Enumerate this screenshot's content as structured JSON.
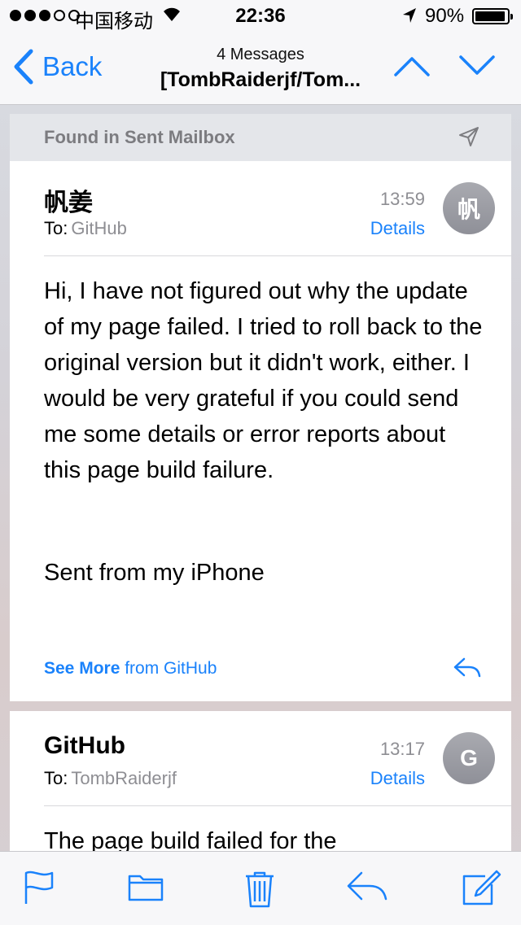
{
  "status_bar": {
    "carrier": "中国移动",
    "time": "22:36",
    "battery": "90%"
  },
  "nav": {
    "back_label": "Back",
    "subtitle": "4 Messages",
    "title": "[TombRaiderjf/Tom..."
  },
  "thread": {
    "found_label": "Found in Sent Mailbox"
  },
  "messages": [
    {
      "sender": "帆姜",
      "to_label": "To:",
      "recipient": "GitHub",
      "time": "13:59",
      "details_label": "Details",
      "avatar_initial": "帆",
      "body": "Hi, I have not figured out why the update of my page failed. I tried to roll back to the original version but it didn't work, either. I would be very grateful if you could send me some details or error reports about this page build failure.",
      "signature": "Sent from my iPhone",
      "see_more_label": "See More",
      "see_more_from": "from GitHub"
    },
    {
      "sender": "GitHub",
      "to_label": "To:",
      "recipient": "TombRaiderjf",
      "time": "13:17",
      "details_label": "Details",
      "avatar_initial": "G",
      "body": "The page build failed for the"
    }
  ],
  "colors": {
    "accent": "#1a82fb",
    "secondary_text": "#8e8e93"
  },
  "icons": [
    "flag-icon",
    "folder-icon",
    "trash-icon",
    "reply-icon",
    "compose-icon"
  ]
}
